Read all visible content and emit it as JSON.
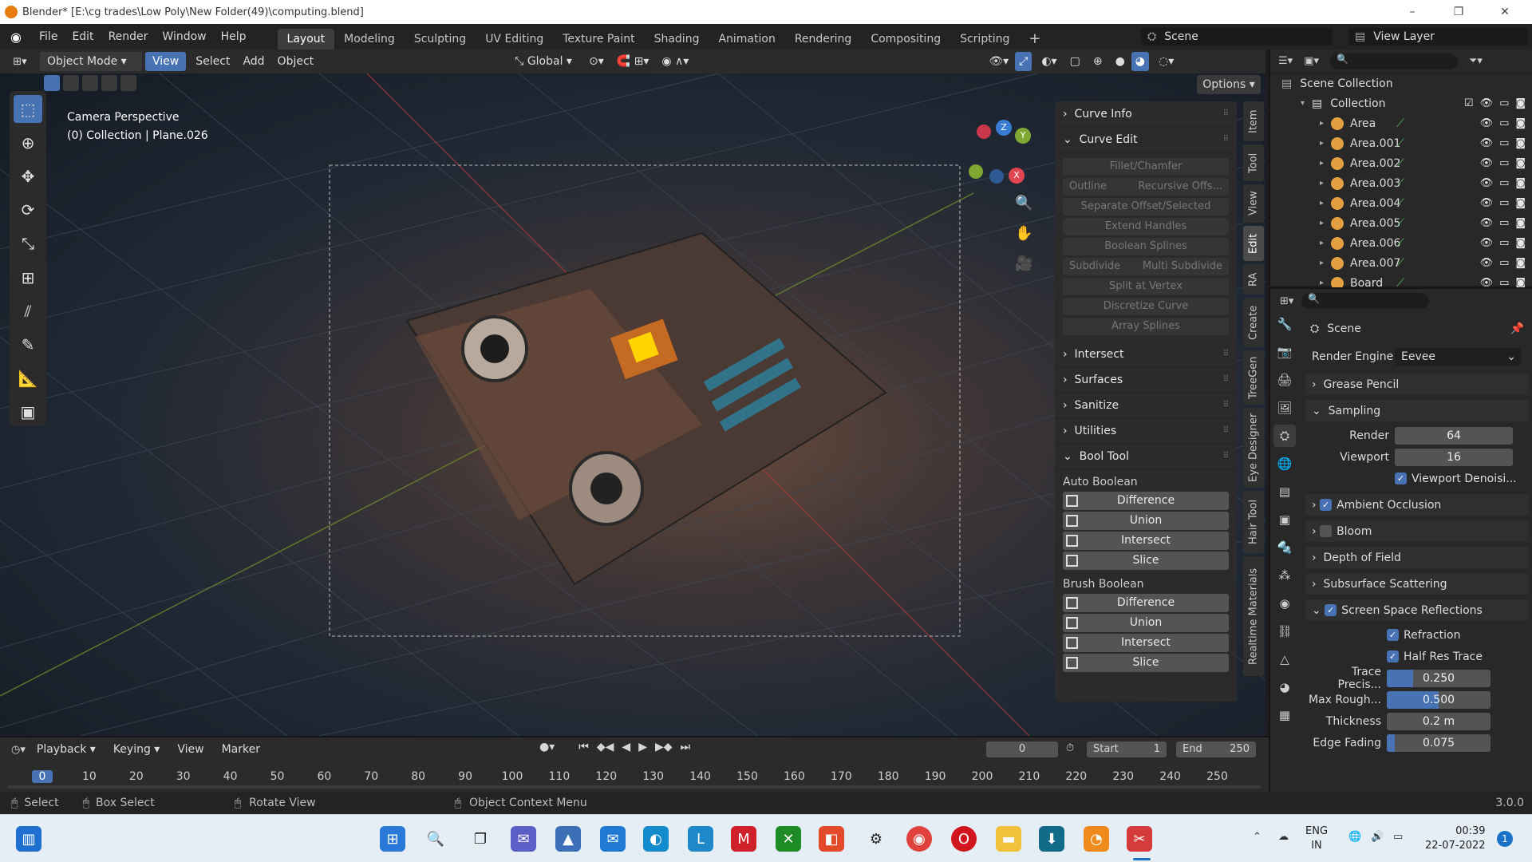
{
  "window": {
    "title": "Blender* [E:\\cg trades\\Low Poly\\New Folder(49)\\computing.blend]",
    "minimize": "–",
    "maximize": "❐",
    "close": "✕"
  },
  "menubar": {
    "menus": [
      "File",
      "Edit",
      "Render",
      "Window",
      "Help"
    ],
    "workspaces": [
      "Layout",
      "Modeling",
      "Sculpting",
      "UV Editing",
      "Texture Paint",
      "Shading",
      "Animation",
      "Rendering",
      "Compositing",
      "Scripting"
    ],
    "add_workspace": "+",
    "scene": "Scene",
    "view_layer": "View Layer"
  },
  "viewport_header": {
    "mode": "Object Mode",
    "menus": [
      "View",
      "Select",
      "Add",
      "Object"
    ],
    "orientation": "Global",
    "options": "Options"
  },
  "viewport": {
    "camera_label": "Camera Perspective",
    "collection_label": "(0) Collection | Plane.026",
    "gizmo": {
      "z": "Z",
      "y": "Y",
      "x": "X"
    }
  },
  "npanel": {
    "sections_top": [
      "Curve Info",
      "Curve Edit"
    ],
    "curve_edit_buttons": [
      "Fillet/Chamfer"
    ],
    "curve_edit_pair1": [
      "Outline",
      "Recursive Offs..."
    ],
    "curve_edit_buttons2": [
      "Separate Offset/Selected",
      "Extend Handles",
      "Boolean Splines"
    ],
    "curve_edit_pair2": [
      "Subdivide",
      "Multi Subdivide"
    ],
    "curve_edit_buttons3": [
      "Split at Vertex",
      "Discretize Curve",
      "Array Splines"
    ],
    "sections_mid": [
      "Intersect",
      "Surfaces",
      "Sanitize",
      "Utilities"
    ],
    "bool_tool": "Bool Tool",
    "auto_boolean": "Auto Boolean",
    "brush_boolean": "Brush Boolean",
    "bool_ops": [
      "Difference",
      "Union",
      "Intersect",
      "Slice"
    ]
  },
  "vtabs": [
    "Item",
    "Tool",
    "View",
    "Edit",
    "RA",
    "Create",
    "TreeGen",
    "Eye Designer",
    "Hair Tool",
    "Realtime Materials"
  ],
  "outliner": {
    "scene_collection": "Scene Collection",
    "collection": "Collection",
    "items": [
      "Area",
      "Area.001",
      "Area.002",
      "Area.003",
      "Area.004",
      "Area.005",
      "Area.006",
      "Area.007",
      "Board"
    ]
  },
  "properties": {
    "scene": "Scene",
    "render_engine_label": "Render Engine",
    "render_engine": "Eevee",
    "grease_pencil": "Grease Pencil",
    "sampling": "Sampling",
    "render_label": "Render",
    "render_value": "64",
    "viewport_label": "Viewport",
    "viewport_value": "16",
    "viewport_denoise": "Viewport Denoisi...",
    "ambient_occlusion": "Ambient Occlusion",
    "bloom": "Bloom",
    "depth_of_field": "Depth of Field",
    "subsurface": "Subsurface Scattering",
    "ssr": "Screen Space Reflections",
    "refraction": "Refraction",
    "half_res": "Half Res Trace",
    "trace_label": "Trace Precis...",
    "trace_value": "0.250",
    "trace_fill": 0.25,
    "rough_label": "Max Rough...",
    "rough_value": "0.500",
    "rough_fill": 0.5,
    "thickness_label": "Thickness",
    "thickness_value": "0.2 m",
    "edge_label": "Edge Fading",
    "edge_value": "0.075",
    "edge_fill": 0.075
  },
  "timeline": {
    "menus": [
      "Playback",
      "Keying",
      "View",
      "Marker"
    ],
    "current_frame": "0",
    "start_label": "Start",
    "start": "1",
    "end_label": "End",
    "end": "250",
    "ticks": [
      "0",
      "10",
      "20",
      "30",
      "40",
      "50",
      "60",
      "70",
      "80",
      "90",
      "100",
      "110",
      "120",
      "130",
      "140",
      "150",
      "160",
      "170",
      "180",
      "190",
      "200",
      "210",
      "220",
      "230",
      "240",
      "250"
    ]
  },
  "statusbar": {
    "select": "Select",
    "box_select": "Box Select",
    "rotate_view": "Rotate View",
    "context_menu": "Object Context Menu",
    "version": "3.0.0"
  },
  "taskbar": {
    "lang": "ENG",
    "region": "IN",
    "time": "00:39",
    "date": "22-07-2022",
    "notif": "1"
  }
}
